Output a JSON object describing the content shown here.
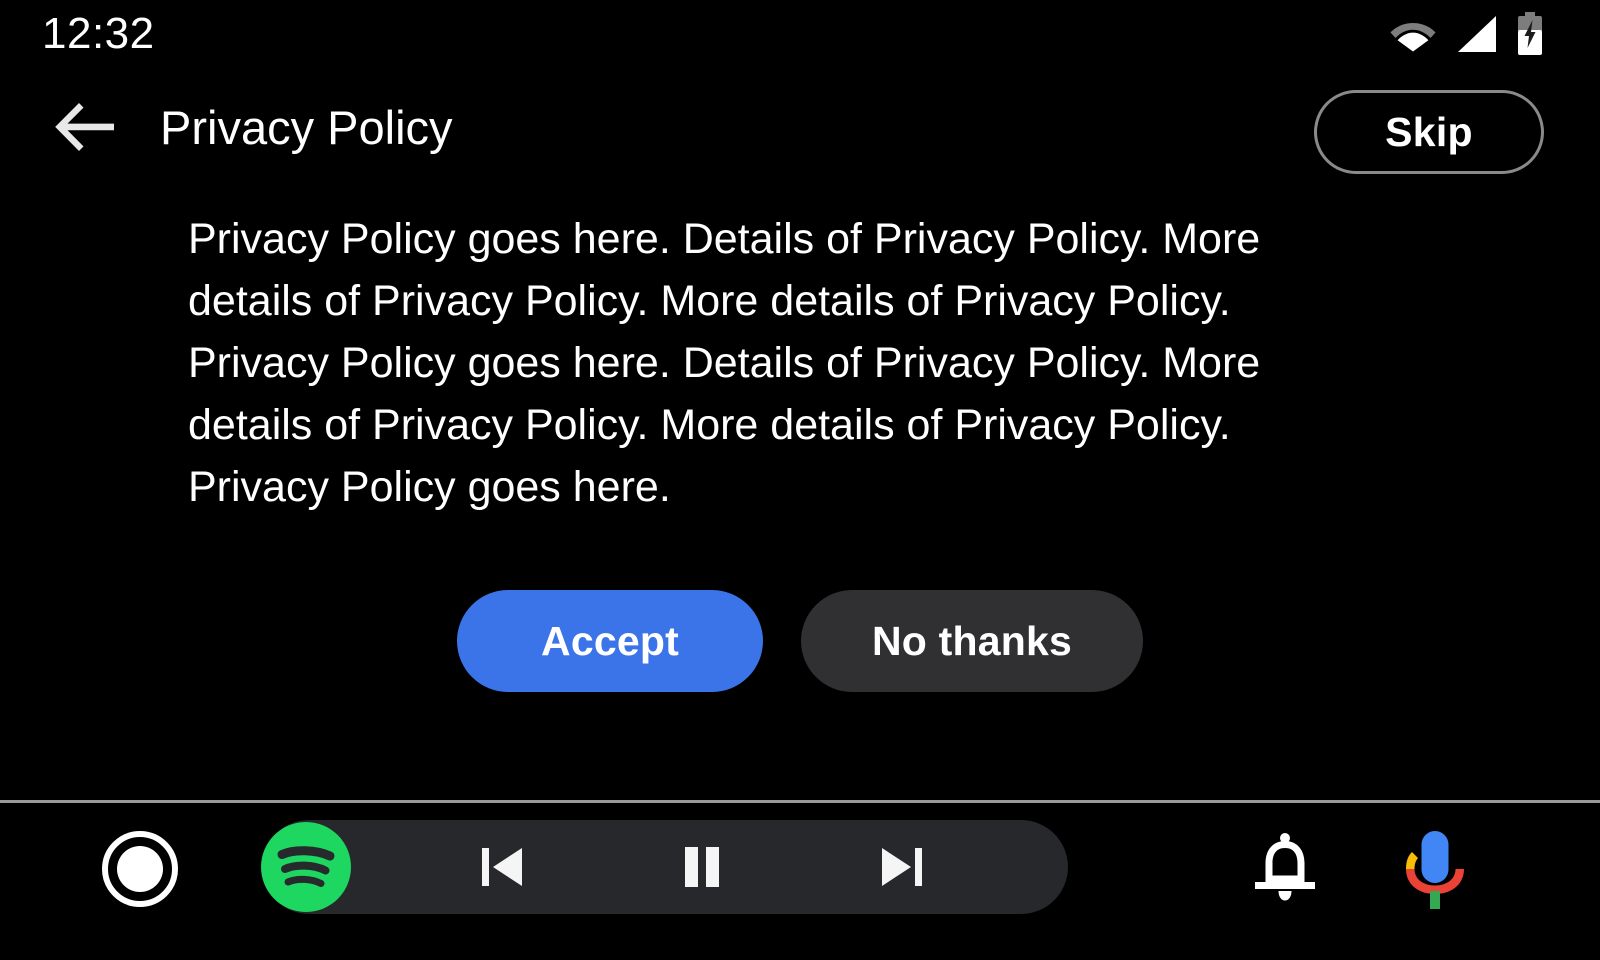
{
  "status_bar": {
    "clock": "12:32",
    "icons": [
      {
        "name": "wifi-icon",
        "label": "Wi-Fi"
      },
      {
        "name": "cellular-signal-icon",
        "label": "Cellular signal"
      },
      {
        "name": "battery-charging-icon",
        "label": "Battery charging"
      }
    ]
  },
  "app_bar": {
    "back_label": "Back",
    "title": "Privacy Policy",
    "skip_label": "Skip"
  },
  "content": {
    "policy_text": "Privacy Policy goes here. Details of Privacy Policy. More details of Privacy Policy. More details of Privacy Policy. Privacy Policy goes here. Details of Privacy Policy. More details of Privacy Policy. More details of Privacy Policy. Privacy Policy goes here.",
    "accept_label": "Accept",
    "no_thanks_label": "No thanks"
  },
  "nav_bar": {
    "home_label": "Home",
    "media_app": "Spotify",
    "previous_label": "Previous track",
    "pause_label": "Pause",
    "next_label": "Next track",
    "notifications_label": "Notifications",
    "assistant_label": "Google Assistant"
  },
  "colors": {
    "background": "#000000",
    "accept_blue": "#3b74e8",
    "no_thanks_gray": "#303033",
    "media_pill": "#27282c",
    "spotify_green": "#1ed760",
    "divider": "#9a9a9a",
    "skip_outline": "#8a8a8a",
    "assistant_blue": "#4285f4",
    "assistant_red": "#ea4335",
    "assistant_yellow": "#fbbc05",
    "assistant_green": "#34a853"
  }
}
